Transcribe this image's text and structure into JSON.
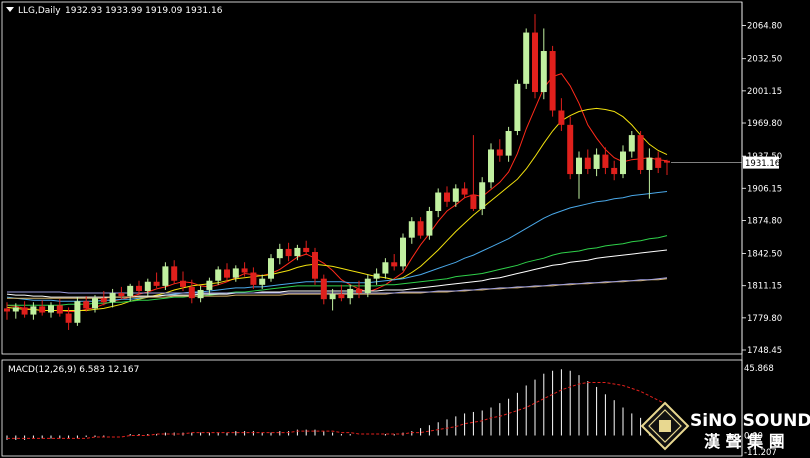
{
  "header": {
    "symbol": "LLG,Daily",
    "ohlc": "1932.93 1933.99 1919.09 1931.16"
  },
  "price_axis": {
    "ticks": [
      "2064.80",
      "2032.50",
      "2001.15",
      "1969.80",
      "1937.50",
      "1906.15",
      "1874.80",
      "1842.50",
      "1811.15",
      "1779.80",
      "1748.45"
    ],
    "current_price": "1931.16"
  },
  "macd": {
    "label": "MACD(12,26,9) 6.583 12.167",
    "ticks": [
      "45.868",
      "0.00",
      "-11.207"
    ]
  },
  "logo": {
    "name": "SiNO SOUND",
    "chinese": "漢 聲 集 團"
  },
  "colors": {
    "background": "#000000",
    "bull": "#c1f0a0",
    "bear": "#e0201c",
    "ma5": "#ff2a1a",
    "ma10": "#f2e20e",
    "ma20": "#4aa8e8",
    "ma30": "#2fd04a",
    "ma60": "#ffffff",
    "ma120": "#d6b46a",
    "ma240": "#9e9ee0",
    "macd_hist": "#ffffff",
    "macd_signal": "#e0201c"
  },
  "chart_data": {
    "type": "candlestick",
    "title": "LLG,Daily",
    "ylim": [
      1748.45,
      2080
    ],
    "candles": [
      [
        1789,
        1795,
        1778,
        1786
      ],
      [
        1786,
        1794,
        1779,
        1790
      ],
      [
        1790,
        1796,
        1780,
        1783
      ],
      [
        1783,
        1795,
        1778,
        1791
      ],
      [
        1791,
        1797,
        1782,
        1785
      ],
      [
        1785,
        1795,
        1780,
        1792
      ],
      [
        1792,
        1798,
        1781,
        1784
      ],
      [
        1784,
        1790,
        1768,
        1775
      ],
      [
        1775,
        1800,
        1772,
        1796
      ],
      [
        1796,
        1801,
        1786,
        1789
      ],
      [
        1789,
        1802,
        1785,
        1799
      ],
      [
        1799,
        1806,
        1792,
        1795
      ],
      [
        1795,
        1808,
        1790,
        1804
      ],
      [
        1804,
        1810,
        1798,
        1801
      ],
      [
        1801,
        1813,
        1796,
        1811
      ],
      [
        1811,
        1816,
        1803,
        1806
      ],
      [
        1806,
        1818,
        1801,
        1815
      ],
      [
        1815,
        1824,
        1809,
        1811
      ],
      [
        1811,
        1834,
        1807,
        1830
      ],
      [
        1830,
        1836,
        1813,
        1816
      ],
      [
        1816,
        1825,
        1806,
        1810
      ],
      [
        1810,
        1817,
        1794,
        1799
      ],
      [
        1799,
        1811,
        1795,
        1807
      ],
      [
        1807,
        1819,
        1802,
        1816
      ],
      [
        1816,
        1830,
        1812,
        1827
      ],
      [
        1827,
        1833,
        1815,
        1819
      ],
      [
        1819,
        1831,
        1815,
        1828
      ],
      [
        1828,
        1834,
        1820,
        1824
      ],
      [
        1824,
        1829,
        1808,
        1812
      ],
      [
        1812,
        1822,
        1808,
        1818
      ],
      [
        1818,
        1842,
        1815,
        1838
      ],
      [
        1838,
        1852,
        1832,
        1847
      ],
      [
        1847,
        1853,
        1835,
        1840
      ],
      [
        1840,
        1851,
        1836,
        1848
      ],
      [
        1848,
        1855,
        1841,
        1844
      ],
      [
        1844,
        1848,
        1812,
        1818
      ],
      [
        1818,
        1822,
        1793,
        1798
      ],
      [
        1798,
        1808,
        1787,
        1803
      ],
      [
        1803,
        1812,
        1796,
        1799
      ],
      [
        1799,
        1812,
        1793,
        1808
      ],
      [
        1808,
        1816,
        1799,
        1804
      ],
      [
        1804,
        1822,
        1800,
        1818
      ],
      [
        1818,
        1828,
        1812,
        1823
      ],
      [
        1823,
        1838,
        1818,
        1834
      ],
      [
        1834,
        1842,
        1826,
        1830
      ],
      [
        1830,
        1862,
        1826,
        1858
      ],
      [
        1858,
        1878,
        1852,
        1874
      ],
      [
        1874,
        1878,
        1857,
        1860
      ],
      [
        1860,
        1888,
        1856,
        1884
      ],
      [
        1884,
        1906,
        1878,
        1902
      ],
      [
        1902,
        1908,
        1888,
        1893
      ],
      [
        1893,
        1910,
        1888,
        1906
      ],
      [
        1906,
        1912,
        1897,
        1900
      ],
      [
        1900,
        1958,
        1884,
        1886
      ],
      [
        1886,
        1917,
        1880,
        1912
      ],
      [
        1912,
        1950,
        1906,
        1944
      ],
      [
        1944,
        1954,
        1932,
        1938
      ],
      [
        1938,
        1966,
        1932,
        1962
      ],
      [
        1962,
        2012,
        1958,
        2008
      ],
      [
        2008,
        2062,
        2003,
        2058
      ],
      [
        2058,
        2076,
        1994,
        2000
      ],
      [
        2000,
        2062,
        1993,
        2040
      ],
      [
        2040,
        2045,
        1976,
        1982
      ],
      [
        1982,
        1994,
        1962,
        1968
      ],
      [
        1968,
        1976,
        1915,
        1920
      ],
      [
        1920,
        1942,
        1896,
        1936
      ],
      [
        1936,
        1944,
        1920,
        1925
      ],
      [
        1925,
        1945,
        1918,
        1939
      ],
      [
        1939,
        1946,
        1920,
        1926
      ],
      [
        1926,
        1933,
        1914,
        1920
      ],
      [
        1920,
        1948,
        1916,
        1942
      ],
      [
        1942,
        1962,
        1936,
        1958
      ],
      [
        1958,
        1962,
        1920,
        1924
      ],
      [
        1924,
        1945,
        1896,
        1936
      ],
      [
        1936,
        1942,
        1921,
        1926
      ],
      [
        1932.93,
        1933.99,
        1919.09,
        1931.16
      ]
    ],
    "moving_averages": [
      {
        "color": "#ff2a1a",
        "values": [
          1792,
          1791,
          1789,
          1788,
          1787,
          1787,
          1787,
          1786,
          1786,
          1788,
          1790,
          1793,
          1796,
          1798,
          1800,
          1803,
          1805,
          1808,
          1810,
          1813,
          1815,
          1814,
          1811,
          1810,
          1812,
          1815,
          1819,
          1823,
          1822,
          1821,
          1823,
          1827,
          1833,
          1839,
          1842,
          1838,
          1833,
          1826,
          1817,
          1812,
          1808,
          1805,
          1808,
          1812,
          1818,
          1824,
          1838,
          1851,
          1862,
          1874,
          1884,
          1890,
          1897,
          1900,
          1898,
          1905,
          1912,
          1922,
          1940,
          1964,
          1984,
          2004,
          2015,
          2018,
          2006,
          1989,
          1968,
          1955,
          1944,
          1936,
          1932,
          1934,
          1935,
          1936,
          1934,
          1933
        ]
      },
      {
        "color": "#f2e20e",
        "values": [
          1790,
          1789,
          1788,
          1788,
          1787,
          1787,
          1787,
          1787,
          1787,
          1787,
          1788,
          1789,
          1791,
          1793,
          1796,
          1798,
          1800,
          1802,
          1804,
          1807,
          1809,
          1811,
          1812,
          1813,
          1814,
          1816,
          1818,
          1819,
          1820,
          1821,
          1822,
          1824,
          1826,
          1829,
          1831,
          1832,
          1831,
          1830,
          1828,
          1826,
          1824,
          1822,
          1820,
          1819,
          1817,
          1819,
          1824,
          1830,
          1838,
          1846,
          1855,
          1864,
          1872,
          1880,
          1887,
          1894,
          1901,
          1908,
          1915,
          1925,
          1937,
          1950,
          1962,
          1972,
          1977,
          1981,
          1983,
          1984,
          1983,
          1981,
          1976,
          1968,
          1958,
          1949,
          1943,
          1939
        ]
      },
      {
        "color": "#4aa8e8",
        "values": [
          1800,
          1799,
          1798,
          1797,
          1797,
          1797,
          1796,
          1796,
          1796,
          1796,
          1796,
          1797,
          1797,
          1798,
          1798,
          1799,
          1800,
          1801,
          1802,
          1803,
          1804,
          1805,
          1805,
          1806,
          1807,
          1808,
          1809,
          1809,
          1810,
          1810,
          1811,
          1812,
          1813,
          1814,
          1815,
          1815,
          1815,
          1815,
          1815,
          1814,
          1814,
          1814,
          1815,
          1816,
          1817,
          1818,
          1820,
          1822,
          1825,
          1828,
          1831,
          1834,
          1838,
          1841,
          1845,
          1849,
          1853,
          1857,
          1862,
          1867,
          1872,
          1877,
          1881,
          1884,
          1887,
          1889,
          1891,
          1893,
          1894,
          1896,
          1897,
          1899,
          1900,
          1901,
          1902,
          1903
        ]
      },
      {
        "color": "#2fd04a",
        "values": [
          1792,
          1792,
          1792,
          1792,
          1792,
          1792,
          1792,
          1793,
          1793,
          1793,
          1794,
          1794,
          1795,
          1795,
          1796,
          1797,
          1797,
          1798,
          1799,
          1800,
          1800,
          1801,
          1801,
          1802,
          1803,
          1804,
          1805,
          1805,
          1806,
          1807,
          1808,
          1809,
          1810,
          1811,
          1811,
          1811,
          1811,
          1811,
          1811,
          1811,
          1811,
          1811,
          1811,
          1812,
          1812,
          1813,
          1814,
          1815,
          1816,
          1817,
          1818,
          1820,
          1821,
          1822,
          1823,
          1825,
          1827,
          1829,
          1831,
          1834,
          1836,
          1838,
          1841,
          1843,
          1844,
          1845,
          1847,
          1848,
          1850,
          1851,
          1852,
          1854,
          1855,
          1857,
          1858,
          1860
        ]
      },
      {
        "color": "#ffffff",
        "values": [
          1803,
          1802,
          1802,
          1801,
          1801,
          1800,
          1800,
          1800,
          1800,
          1800,
          1800,
          1800,
          1800,
          1800,
          1800,
          1801,
          1801,
          1801,
          1802,
          1802,
          1802,
          1802,
          1803,
          1803,
          1803,
          1803,
          1804,
          1804,
          1804,
          1805,
          1805,
          1805,
          1806,
          1806,
          1806,
          1806,
          1806,
          1806,
          1806,
          1806,
          1806,
          1806,
          1806,
          1807,
          1807,
          1807,
          1808,
          1809,
          1810,
          1811,
          1812,
          1813,
          1814,
          1815,
          1816,
          1818,
          1819,
          1821,
          1823,
          1825,
          1827,
          1829,
          1831,
          1832,
          1834,
          1835,
          1836,
          1838,
          1839,
          1840,
          1841,
          1842,
          1843,
          1844,
          1845,
          1846
        ]
      },
      {
        "color": "#d6b46a",
        "values": [
          1799,
          1799,
          1799,
          1799,
          1799,
          1799,
          1799,
          1799,
          1799,
          1799,
          1799,
          1799,
          1800,
          1800,
          1800,
          1800,
          1800,
          1800,
          1800,
          1801,
          1801,
          1801,
          1801,
          1801,
          1801,
          1801,
          1802,
          1802,
          1802,
          1802,
          1802,
          1802,
          1803,
          1803,
          1803,
          1803,
          1803,
          1803,
          1803,
          1803,
          1803,
          1803,
          1803,
          1803,
          1804,
          1804,
          1804,
          1804,
          1805,
          1805,
          1805,
          1806,
          1806,
          1807,
          1807,
          1808,
          1808,
          1809,
          1809,
          1810,
          1810,
          1811,
          1811,
          1812,
          1812,
          1813,
          1813,
          1814,
          1814,
          1815,
          1815,
          1816,
          1816,
          1817,
          1817,
          1818
        ]
      },
      {
        "color": "#9e9ee0",
        "values": [
          1805,
          1805,
          1805,
          1805,
          1805,
          1805,
          1805,
          1804,
          1804,
          1804,
          1804,
          1804,
          1804,
          1804,
          1804,
          1804,
          1804,
          1804,
          1804,
          1804,
          1804,
          1804,
          1804,
          1804,
          1804,
          1804,
          1804,
          1804,
          1804,
          1804,
          1804,
          1804,
          1804,
          1804,
          1804,
          1804,
          1804,
          1804,
          1804,
          1804,
          1804,
          1804,
          1804,
          1804,
          1804,
          1805,
          1805,
          1805,
          1805,
          1806,
          1806,
          1806,
          1807,
          1807,
          1808,
          1808,
          1809,
          1809,
          1810,
          1810,
          1811,
          1811,
          1812,
          1812,
          1813,
          1813,
          1814,
          1814,
          1815,
          1815,
          1816,
          1816,
          1817,
          1817,
          1818,
          1819
        ]
      }
    ],
    "macd_histogram": [
      -3,
      -3,
      -3,
      -2,
      -2,
      -2,
      -2,
      -2,
      -2,
      -1,
      -1,
      -1,
      0,
      0,
      1,
      1,
      1,
      1,
      2,
      2,
      2,
      2,
      2,
      2,
      2,
      2,
      3,
      3,
      3,
      2,
      2,
      3,
      3,
      4,
      4,
      4,
      3,
      2,
      1,
      1,
      0,
      0,
      0,
      1,
      1,
      2,
      3,
      5,
      7,
      9,
      11,
      13,
      15,
      16,
      17,
      19,
      22,
      25,
      29,
      34,
      38,
      42,
      44,
      45,
      44,
      41,
      37,
      33,
      28,
      24,
      19,
      15,
      12,
      10,
      8,
      7
    ],
    "macd_signal": [
      -2,
      -2,
      -2,
      -2,
      -2,
      -2,
      -2,
      -2,
      -2,
      -2,
      -1,
      -1,
      -1,
      -1,
      0,
      0,
      0,
      1,
      1,
      1,
      1,
      2,
      2,
      2,
      2,
      2,
      2,
      2,
      2,
      2,
      2,
      2,
      2,
      3,
      3,
      3,
      3,
      3,
      2,
      2,
      1,
      1,
      1,
      1,
      1,
      1,
      2,
      2,
      3,
      4,
      5,
      6,
      8,
      9,
      10,
      12,
      13,
      15,
      17,
      19,
      22,
      25,
      28,
      31,
      33,
      35,
      36,
      36,
      36,
      35,
      34,
      32,
      30,
      27,
      24,
      21
    ]
  }
}
